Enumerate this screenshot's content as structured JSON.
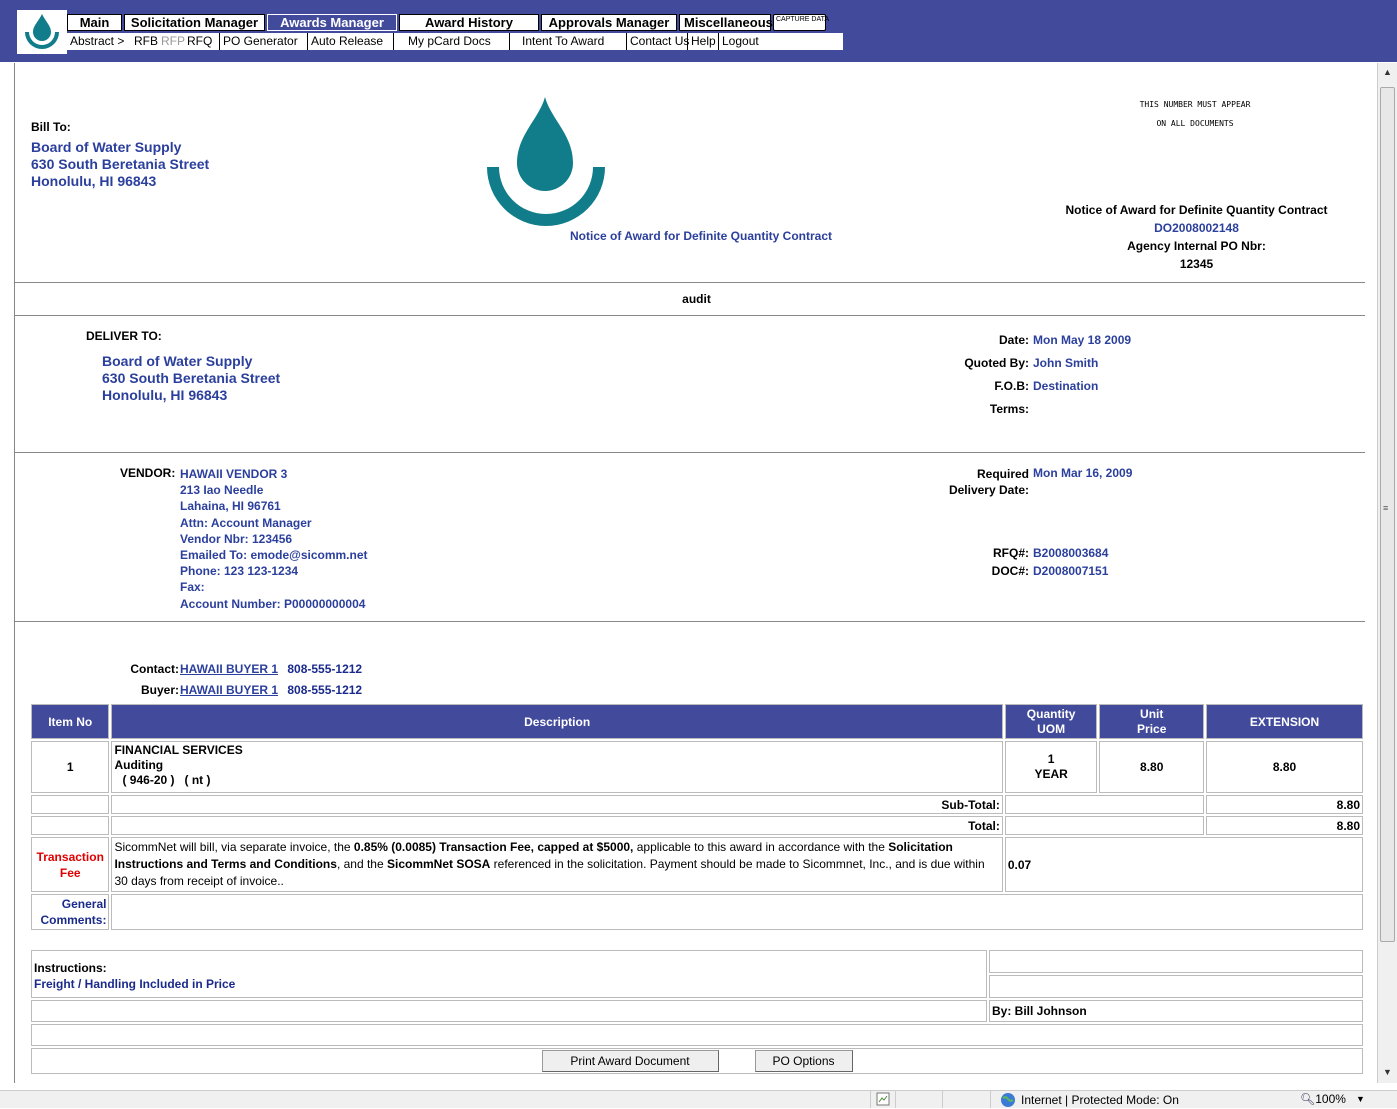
{
  "nav": {
    "primary": [
      {
        "label": "Main"
      },
      {
        "label": "Solicitation Manager"
      },
      {
        "label": "Awards Manager"
      },
      {
        "label": "Award History"
      },
      {
        "label": "Approvals Manager"
      },
      {
        "label": "Miscellaneous"
      },
      {
        "label": "CAPTURE DATA"
      }
    ],
    "secondary": [
      {
        "label": "Abstract >"
      },
      {
        "label": "RFB"
      },
      {
        "label": "RFP"
      },
      {
        "label": "RFQ"
      },
      {
        "label": "PO Generator"
      },
      {
        "label": "Auto Release"
      },
      {
        "label": "My pCard Docs"
      },
      {
        "label": "Intent To Award"
      },
      {
        "label": "Contact Us"
      },
      {
        "label": "Help"
      },
      {
        "label": "Logout"
      }
    ]
  },
  "header": {
    "bill_to_label": "Bill To:",
    "bill_to": [
      "Board of Water Supply",
      "630 South Beretania Street",
      "Honolulu, HI 96843"
    ],
    "center_title": "Notice of Award for Definite Quantity Contract",
    "notice_line1": "THIS NUMBER MUST APPEAR",
    "notice_line2": "ON ALL DOCUMENTS",
    "right_title": "Notice of Award for Definite Quantity Contract",
    "doc_number": "DO2008002148",
    "agency_po_label": "Agency Internal PO Nbr:",
    "agency_po": "12345"
  },
  "section_title": "audit",
  "delivery": {
    "label": "DELIVER TO:",
    "address": [
      "Board of Water Supply",
      "630 South Beretania Street",
      "Honolulu, HI 96843"
    ],
    "date_label": "Date:",
    "date": "Mon May 18 2009",
    "quoted_by_label": "Quoted By:",
    "quoted_by": "John Smith",
    "fob_label": "F.O.B:",
    "fob": "Destination",
    "terms_label": "Terms:",
    "terms": ""
  },
  "vendor": {
    "label": "VENDOR:",
    "name": "HAWAII VENDOR 3",
    "lines": [
      "213 Iao Needle",
      "Lahaina, HI 96761",
      "Attn: Account Manager",
      "Vendor Nbr: 123456",
      "Emailed To: emode@sicomm.net",
      "Phone: 123 123-1234",
      "Fax:",
      "Account Number: P00000000004"
    ],
    "required_label": "Required",
    "delivery_date_label": "Delivery Date:",
    "required_date": "Mon Mar 16, 2009",
    "rfq_label": "RFQ#:",
    "rfq": "B2008003684",
    "doc_label": "DOC#:",
    "doc": "D2008007151"
  },
  "contacts": {
    "contact_label": "Contact:",
    "contact_name": "HAWAII BUYER 1",
    "contact_phone": "808-555-1212",
    "buyer_label": "Buyer:",
    "buyer_name": "HAWAII BUYER 1",
    "buyer_phone": "808-555-1212"
  },
  "table": {
    "headers": {
      "item_no": "Item No",
      "description": "Description",
      "quantity": "Quantity",
      "uom": "UOM",
      "unit": "Unit",
      "price": "Price",
      "extension": "EXTENSION"
    },
    "rows": [
      {
        "item_no": "1",
        "desc_line1": "FINANCIAL SERVICES",
        "desc_line2": "Auditing",
        "desc_line3": "( 946-20 )   ( nt )",
        "qty": "1",
        "uom": "YEAR",
        "unit_price": "8.80",
        "extension": "8.80"
      }
    ],
    "subtotal_label": "Sub-Total:",
    "subtotal": "8.80",
    "total_label": "Total:",
    "total": "8.80",
    "fee_label1": "Transaction",
    "fee_label2": "Fee",
    "fee_text_1": "SicommNet will bill, via separate invoice, the ",
    "fee_text_2": "0.85% (0.0085) Transaction Fee, capped at $5000,",
    "fee_text_3": " applicable to this award in accordance with the ",
    "fee_text_4": "Solicitation Instructions and Terms and Conditions",
    "fee_text_5": ", and the ",
    "fee_text_6": "SicommNet SOSA",
    "fee_text_7": " referenced in the solicitation. Payment should be made to Sicommnet, Inc., and is due within 30 days from receipt of invoice..",
    "fee_value": "0.07",
    "general_comments_label1": "General",
    "general_comments_label2": "Comments:",
    "instructions_label": "Instructions:",
    "instructions": "Freight / Handling Included in Price",
    "by_label": "By: Bill Johnson"
  },
  "buttons": {
    "print": "Print Award Document",
    "po_options": "PO Options"
  },
  "statusbar": {
    "zone": "Internet | Protected Mode: On",
    "zoom": "100%"
  },
  "colors": {
    "nav_bg": "#424a9c",
    "link_blue": "#2b3f9c",
    "logo_teal": "#117d8a",
    "fee_red": "#e00000"
  }
}
